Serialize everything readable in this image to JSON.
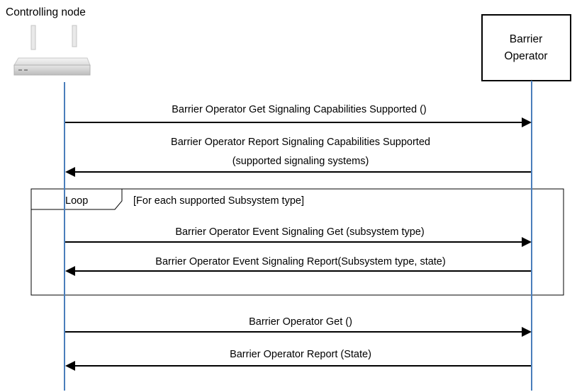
{
  "participants": {
    "controller": {
      "label": "Controlling node",
      "icon": "router-icon"
    },
    "barrier": {
      "label_line1": "Barrier",
      "label_line2": "Operator"
    }
  },
  "messages": [
    {
      "line1": "Barrier Operator Get Signaling Capabilities Supported ()",
      "direction": "to-barrier"
    },
    {
      "line1": "Barrier Operator Report Signaling Capabilities Supported",
      "line2": "(supported signaling systems)",
      "direction": "to-controller"
    },
    {
      "line1": "Barrier Operator Event Signaling Get (subsystem type)",
      "direction": "to-barrier"
    },
    {
      "line1": "Barrier Operator Event Signaling Report(Subsystem type, state)",
      "direction": "to-controller"
    },
    {
      "line1": "Barrier Operator Get ()",
      "direction": "to-barrier"
    },
    {
      "line1": "Barrier Operator Report (State)",
      "direction": "to-controller"
    }
  ],
  "loop": {
    "keyword": "Loop",
    "condition": "[For each supported Subsystem type]"
  },
  "colors": {
    "lifeline": "#4a7ebb",
    "arrow": "#000000",
    "frame": "#000000"
  }
}
